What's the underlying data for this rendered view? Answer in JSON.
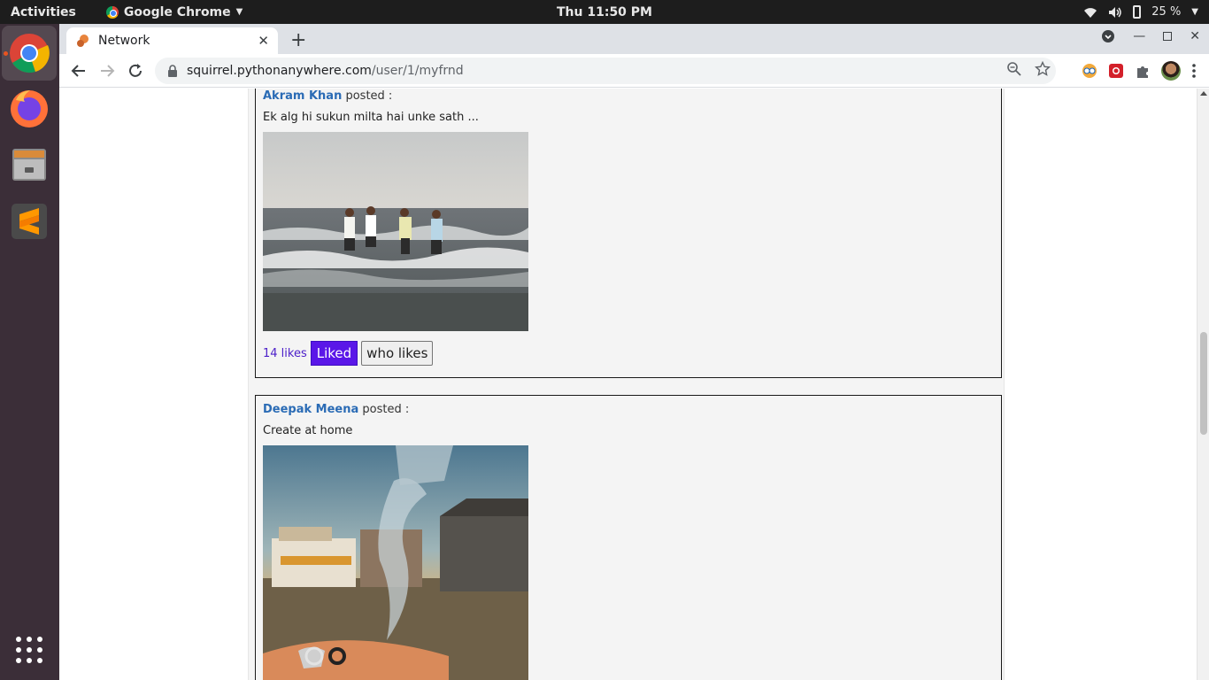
{
  "topbar": {
    "activities": "Activities",
    "app_name": "Google Chrome",
    "clock": "Thu 11:50 PM",
    "battery": "25 %"
  },
  "dock": {
    "items": [
      "chrome-icon",
      "firefox-icon",
      "files-icon",
      "sublime-text-icon",
      "app-grid-icon"
    ]
  },
  "browser": {
    "tab_title": "Network",
    "url_host": "squirrel.pythonanywhere.com",
    "url_path": "/user/1/myfrnd"
  },
  "posts": [
    {
      "author": "Akram Khan",
      "posted": "posted :",
      "caption": "Ek alg hi sukun milta hai unke sath ...",
      "likes": "14 likes",
      "liked_label": "Liked",
      "who_likes_label": "who likes"
    },
    {
      "author": "Deepak Meena",
      "posted": "posted :",
      "caption": "Create at home"
    }
  ],
  "colors": {
    "accent": "#5a17e8",
    "author_link": "#2a6bb5",
    "dock_bg": "#3b2e38"
  }
}
